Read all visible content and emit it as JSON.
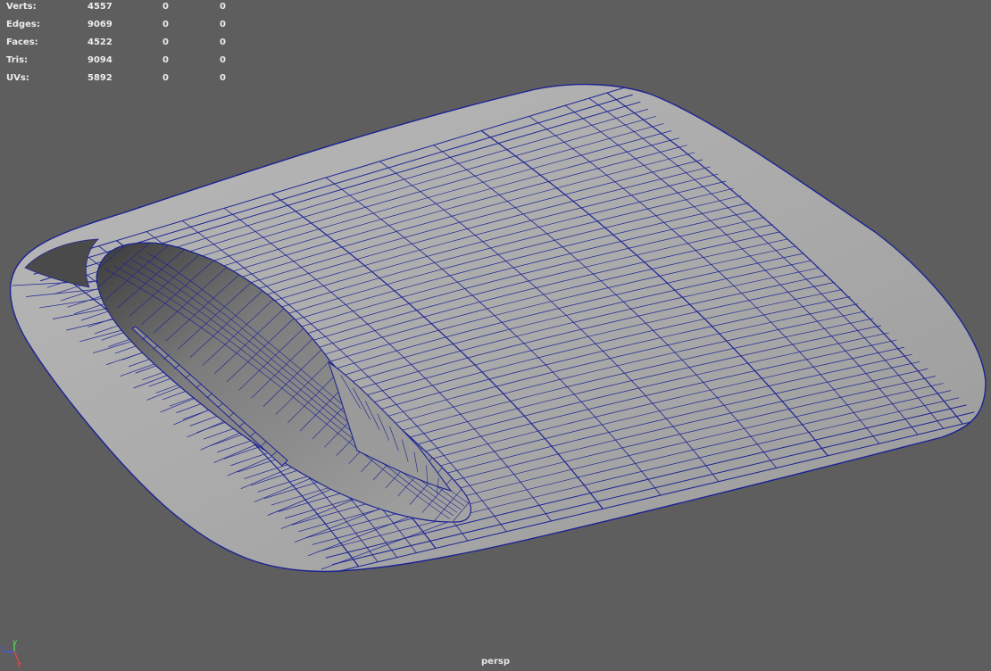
{
  "hud": {
    "rows": [
      {
        "label": "Verts:",
        "total": "4557",
        "sel1": "0",
        "sel2": "0"
      },
      {
        "label": "Edges:",
        "total": "9069",
        "sel1": "0",
        "sel2": "0"
      },
      {
        "label": "Faces:",
        "total": "4522",
        "sel1": "0",
        "sel2": "0"
      },
      {
        "label": "Tris:",
        "total": "9094",
        "sel1": "0",
        "sel2": "0"
      },
      {
        "label": "UVs:",
        "total": "5892",
        "sel1": "0",
        "sel2": "0"
      }
    ]
  },
  "axis": {
    "x": "x",
    "y": "y",
    "z": "z"
  },
  "camera": "persp",
  "colors": {
    "background": "#5e5e5e",
    "wire": "#1c2392",
    "surface": "#a8a8a8",
    "axis_x": "#e04848",
    "axis_y": "#5ad05a",
    "axis_z": "#4a5ae8"
  }
}
